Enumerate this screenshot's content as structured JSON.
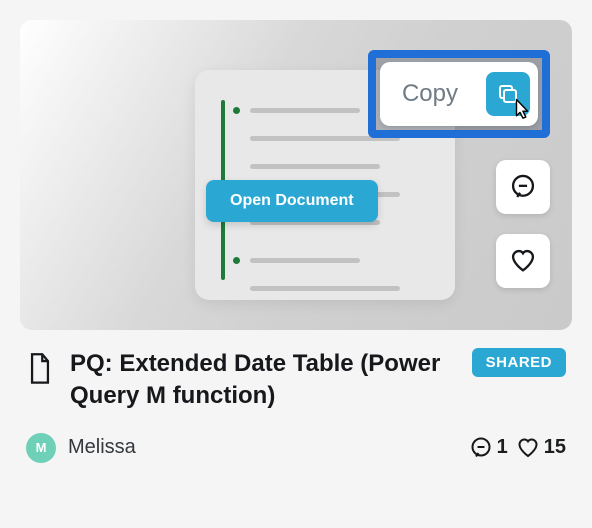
{
  "preview": {
    "copy_label": "Copy",
    "open_label": "Open Document"
  },
  "item": {
    "title": "PQ: Extended Date Table (Power Query M function)",
    "badge": "SHARED",
    "author_initial": "M",
    "author": "Melissa",
    "comments": "1",
    "likes": "15"
  }
}
